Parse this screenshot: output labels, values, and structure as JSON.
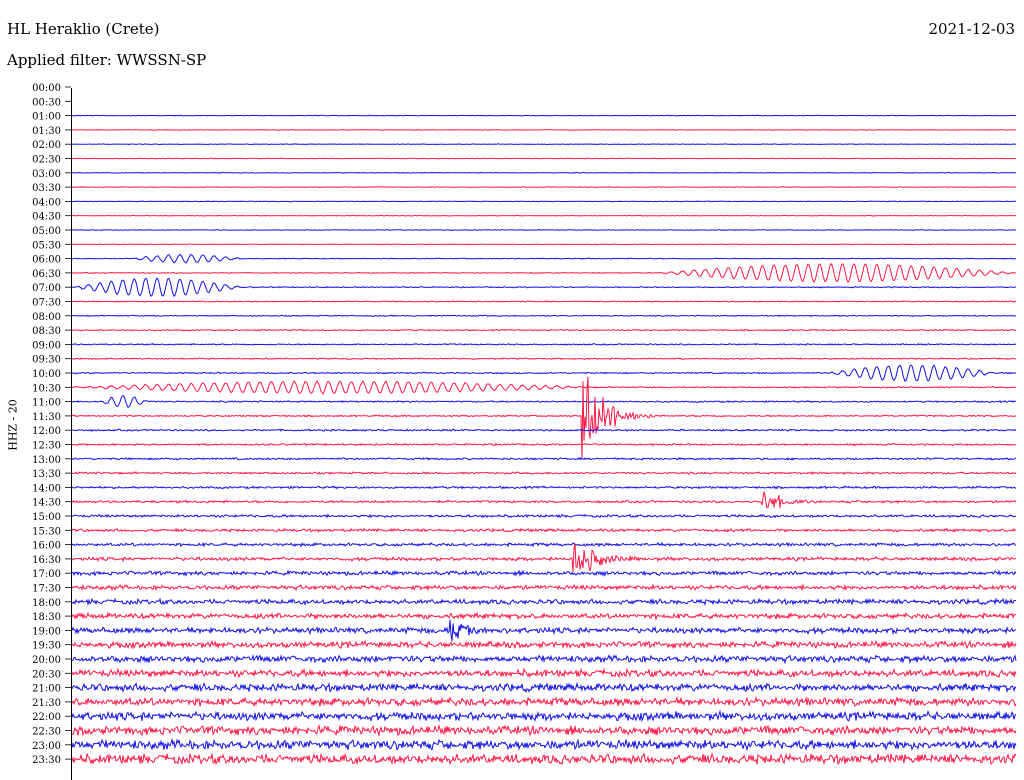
{
  "header": {
    "station": "HL Heraklio (Crete)",
    "date": "2021-12-03",
    "filter_label": "Applied filter: WWSSN-SP"
  },
  "channel_label": "HHZ - 20",
  "colors": {
    "trace_a": "#1010e6",
    "trace_b": "#ff1744",
    "axis": "#000000",
    "background": "#ffffff"
  },
  "chart_data": {
    "type": "line",
    "title": "HL Heraklio (Crete)",
    "subtitle": "Applied filter: WWSSN-SP",
    "ylabel": "HHZ - 20",
    "xlabel": "",
    "date": "2021-12-03",
    "row_labels": [
      "00:00",
      "00:30",
      "01:00",
      "01:30",
      "02:00",
      "02:30",
      "03:00",
      "03:30",
      "04:00",
      "04:30",
      "05:00",
      "05:30",
      "06:00",
      "06:30",
      "07:00",
      "07:30",
      "08:00",
      "08:30",
      "09:00",
      "09:30",
      "10:00",
      "10:30",
      "11:00",
      "11:30",
      "12:00",
      "12:30",
      "13:00",
      "13:30",
      "14:00",
      "14:30",
      "15:00",
      "15:30",
      "16:00",
      "16:30",
      "17:00",
      "17:30",
      "18:00",
      "18:30",
      "19:00",
      "19:30",
      "20:00",
      "20:30",
      "21:00",
      "21:30",
      "22:00",
      "22:30",
      "23:00",
      "23:30"
    ],
    "first_trace_row": "01:00",
    "series_colors": [
      "#1010e6",
      "#ff1744"
    ],
    "row_noise_level": [
      0,
      0,
      3,
      3,
      3,
      3,
      3,
      3,
      3,
      3,
      3,
      3,
      4,
      4,
      5,
      5,
      5,
      6,
      6,
      6,
      6,
      6,
      7,
      7,
      8,
      8,
      9,
      9,
      10,
      11,
      12,
      13,
      14,
      16,
      18,
      20,
      22,
      24,
      26,
      28,
      30,
      32,
      34,
      36,
      38,
      40,
      42,
      44
    ],
    "events": [
      {
        "row": "06:00",
        "start_frac": 0.06,
        "end_frac": 0.18,
        "amplitude": 4
      },
      {
        "row": "06:30",
        "start_frac": 0.62,
        "end_frac": 1.0,
        "amplitude": 9
      },
      {
        "row": "07:00",
        "start_frac": 0.0,
        "end_frac": 0.18,
        "amplitude": 9
      },
      {
        "row": "10:00",
        "start_frac": 0.8,
        "end_frac": 0.98,
        "amplitude": 8
      },
      {
        "row": "10:30",
        "start_frac": 0.0,
        "end_frac": 0.55,
        "amplitude": 6
      },
      {
        "row": "11:00",
        "start_frac": 0.03,
        "end_frac": 0.08,
        "amplitude": 6
      },
      {
        "row": "11:30",
        "start_frac": 0.54,
        "end_frac": 0.62,
        "amplitude": 75
      },
      {
        "row": "14:30",
        "start_frac": 0.73,
        "end_frac": 0.78,
        "amplitude": 28
      },
      {
        "row": "16:30",
        "start_frac": 0.53,
        "end_frac": 0.6,
        "amplitude": 35
      },
      {
        "row": "19:00",
        "start_frac": 0.4,
        "end_frac": 0.44,
        "amplitude": 20
      }
    ]
  }
}
